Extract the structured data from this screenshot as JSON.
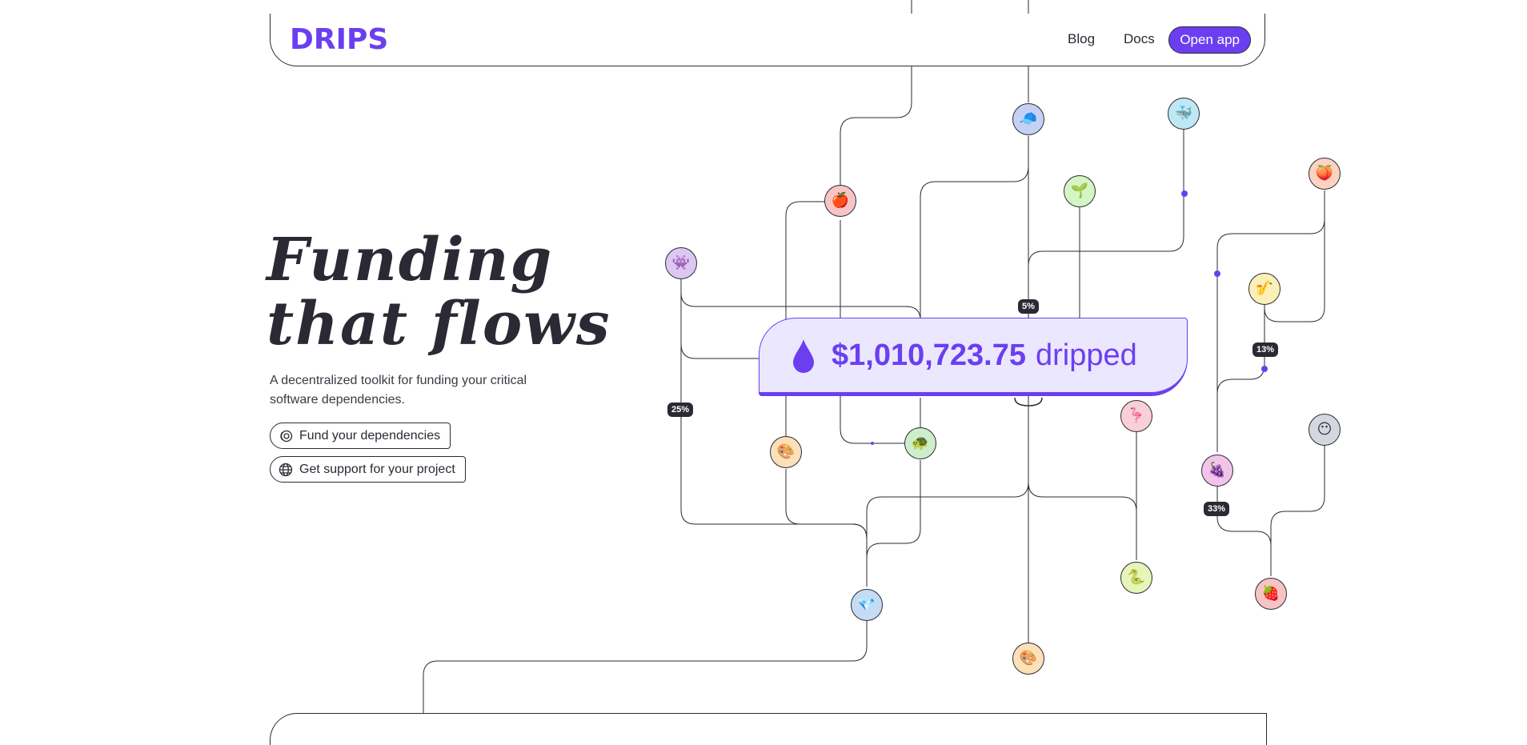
{
  "header": {
    "logo": "DRIPS",
    "nav": {
      "blog": "Blog",
      "docs": "Docs",
      "open_app": "Open app"
    }
  },
  "hero": {
    "title_line1": "Funding",
    "title_line2": "that flows",
    "subtitle": "A decentralized toolkit for funding your critical software dependencies.",
    "cta_fund": "Fund your dependencies",
    "cta_support": "Get support for your project"
  },
  "counter": {
    "amount": "$1,010,723.75",
    "suffix": "dripped"
  },
  "badges": {
    "b5": "5%",
    "b13": "13%",
    "b25": "25%",
    "b33": "33%"
  },
  "nodes": [
    {
      "icon": "whale-icon",
      "emoji": "🐳",
      "color": "#bfe8f5"
    },
    {
      "icon": "cap-icon",
      "emoji": "🧢",
      "color": "#c6d0f5"
    },
    {
      "icon": "peach-icon",
      "emoji": "🍑",
      "color": "#fcd3c0"
    },
    {
      "icon": "seedling-icon",
      "emoji": "🌱",
      "color": "#d4f5c4"
    },
    {
      "icon": "apple-icon",
      "emoji": "🍎",
      "color": "#f7c4c4"
    },
    {
      "icon": "alien-icon",
      "emoji": "👾",
      "color": "#dcc8f3"
    },
    {
      "icon": "saxophone-icon",
      "emoji": "🎷",
      "color": "#fbf1b8"
    },
    {
      "icon": "flamingo-icon",
      "emoji": "🦩",
      "color": "#f9cfd8"
    },
    {
      "icon": "face-icon",
      "emoji": "😶",
      "color": "#d5d7e0"
    },
    {
      "icon": "palette-icon",
      "emoji": "🎨",
      "color": "#fbe0b8"
    },
    {
      "icon": "turtle-icon",
      "emoji": "🐢",
      "color": "#cdeecb"
    },
    {
      "icon": "grapes-icon",
      "emoji": "🍇",
      "color": "#f3c4ea"
    },
    {
      "icon": "snake-icon",
      "emoji": "🐍",
      "color": "#e6f5b8"
    },
    {
      "icon": "strawberry-icon",
      "emoji": "🍓",
      "color": "#f7c4c4"
    },
    {
      "icon": "gem-icon",
      "emoji": "💎",
      "color": "#c6dcf5"
    },
    {
      "icon": "palette-icon",
      "emoji": "🎨",
      "color": "#fbe0b8"
    }
  ],
  "colors": {
    "accent": "#6b3ff0",
    "ink": "#2a2a35",
    "counter_bg": "#ebe7ff"
  }
}
